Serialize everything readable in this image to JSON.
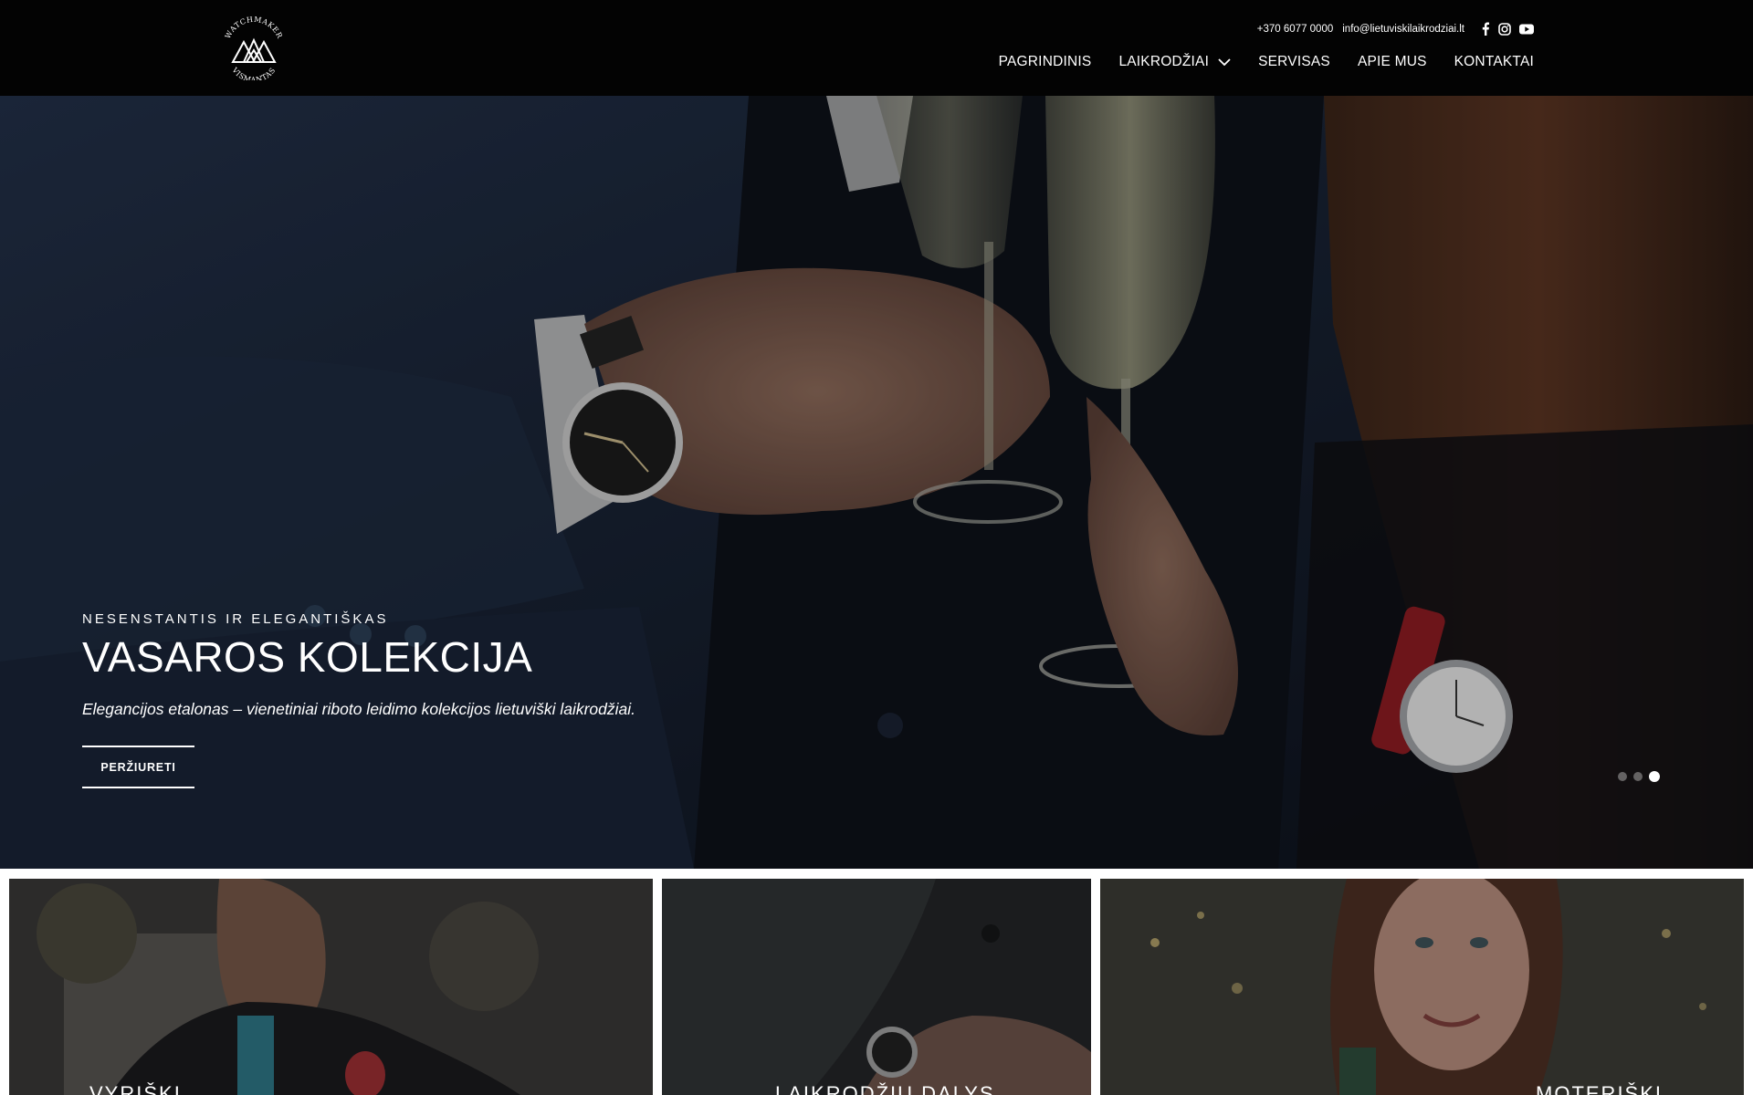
{
  "brand": {
    "logo_alt": "Watchmaker Vismantas",
    "logo_top_text": "WATCHMAKER",
    "logo_bottom_text": "VISMANTAS"
  },
  "header": {
    "phone": "+370 6077 0000",
    "email": "info@lietuviskilaikrodziai.lt",
    "social_icons": [
      "facebook-icon",
      "instagram-icon",
      "youtube-icon"
    ]
  },
  "nav": {
    "items": [
      {
        "label": "PAGRINDINIS"
      },
      {
        "label": "LAIKRODŽIAI",
        "has_dropdown": true
      },
      {
        "label": "SERVISAS"
      },
      {
        "label": "APIE MUS"
      },
      {
        "label": "KONTAKTAI"
      }
    ]
  },
  "hero": {
    "eyebrow": "NESENSTANTIS IR ELEGANTIŠKAS",
    "title": "VASAROS KOLEKCIJA",
    "subtitle": "Elegancijos etalonas – vienetiniai riboto leidimo kolekcijos lietuviški laikrodžiai.",
    "cta_label": "PERŽIURETI",
    "slides_total": 3,
    "active_slide": 3
  },
  "categories": [
    {
      "label": "VYRIŠKI"
    },
    {
      "label": "LAIKRODŽIŲ DALYS"
    },
    {
      "label": "MOTERIŠKI"
    }
  ],
  "colors": {
    "header_bg": "#030303",
    "text": "#ffffff",
    "hero_overlay": "#12161f"
  }
}
